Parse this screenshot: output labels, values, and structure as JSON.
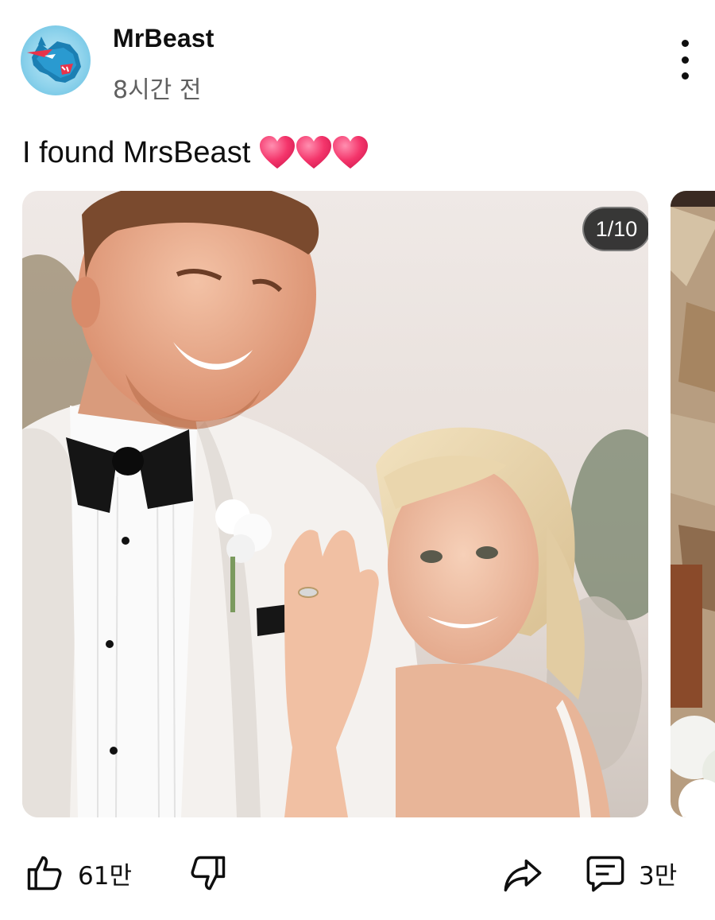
{
  "post": {
    "channel_name": "MrBeast",
    "time_ago": "8시간 전",
    "text": "I found MrsBeast",
    "emoji": [
      "heart",
      "heart",
      "heart"
    ]
  },
  "carousel": {
    "counter": "1/10",
    "current_index": 1,
    "total": 10
  },
  "actions": {
    "like_count": "61만",
    "comment_count": "3만"
  },
  "icons": {
    "like": "thumbs-up-icon",
    "dislike": "thumbs-down-icon",
    "share": "share-icon",
    "comment": "comment-icon",
    "menu": "more-vertical-icon"
  },
  "colors": {
    "text": "#0f0f0f",
    "secondary_text": "#606060",
    "heart": "#f4356b",
    "avatar_bg": "#8fd3ec"
  }
}
